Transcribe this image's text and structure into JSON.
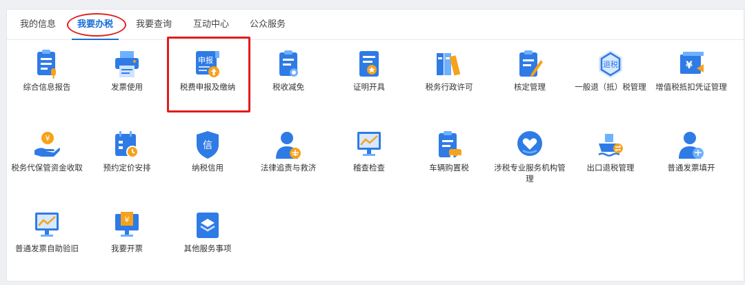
{
  "tabs": [
    {
      "label": "我的信息"
    },
    {
      "label": "我要办税",
      "active": true
    },
    {
      "label": "我要查询"
    },
    {
      "label": "互动中心"
    },
    {
      "label": "公众服务"
    }
  ],
  "services": [
    {
      "label": "综合信息报告",
      "icon": "report-mic-icon"
    },
    {
      "label": "发票使用",
      "icon": "printer-icon"
    },
    {
      "label": "税费申报及缴纳",
      "icon": "declare-pay-icon",
      "icon_text": "申报"
    },
    {
      "label": "税收减免",
      "icon": "tax-relief-icon"
    },
    {
      "label": "证明开具",
      "icon": "certificate-icon"
    },
    {
      "label": "税务行政许可",
      "icon": "binders-icon"
    },
    {
      "label": "核定管理",
      "icon": "clipboard-edit-icon"
    },
    {
      "label": "一般退（抵）税管理",
      "icon": "refund-icon",
      "icon_text": "退税"
    },
    {
      "label": "增值税抵扣凭证管理",
      "icon": "vat-voucher-icon",
      "icon_text": "¥"
    },
    {
      "label": "税务代保管资金收取",
      "icon": "hand-coin-icon",
      "icon_text": "¥"
    },
    {
      "label": "预约定价安排",
      "icon": "calendar-clock-icon"
    },
    {
      "label": "纳税信用",
      "icon": "credit-shield-icon",
      "icon_text": "信"
    },
    {
      "label": "法律追责与救济",
      "icon": "lawyer-icon"
    },
    {
      "label": "稽查检查",
      "icon": "monitor-chart-icon"
    },
    {
      "label": "车辆购置税",
      "icon": "vehicle-clipboard-icon"
    },
    {
      "label": "涉税专业服务机构管理",
      "icon": "service-heart-icon"
    },
    {
      "label": "出口退税管理",
      "icon": "ship-icon"
    },
    {
      "label": "普通发票填开",
      "icon": "person-scale-icon"
    },
    {
      "label": "普通发票自助验旧",
      "icon": "monitor-trend-icon"
    },
    {
      "label": "我要开票",
      "icon": "invoice-screen-icon",
      "icon_text": "¥"
    },
    {
      "label": "其他服务事项",
      "icon": "layers-icon"
    }
  ],
  "colors": {
    "accent": "#1a6fd6",
    "icon_blue": "#2f7be5",
    "icon_light": "#6fb0ff",
    "orange": "#f7a21b",
    "highlight": "#e31b1b"
  }
}
